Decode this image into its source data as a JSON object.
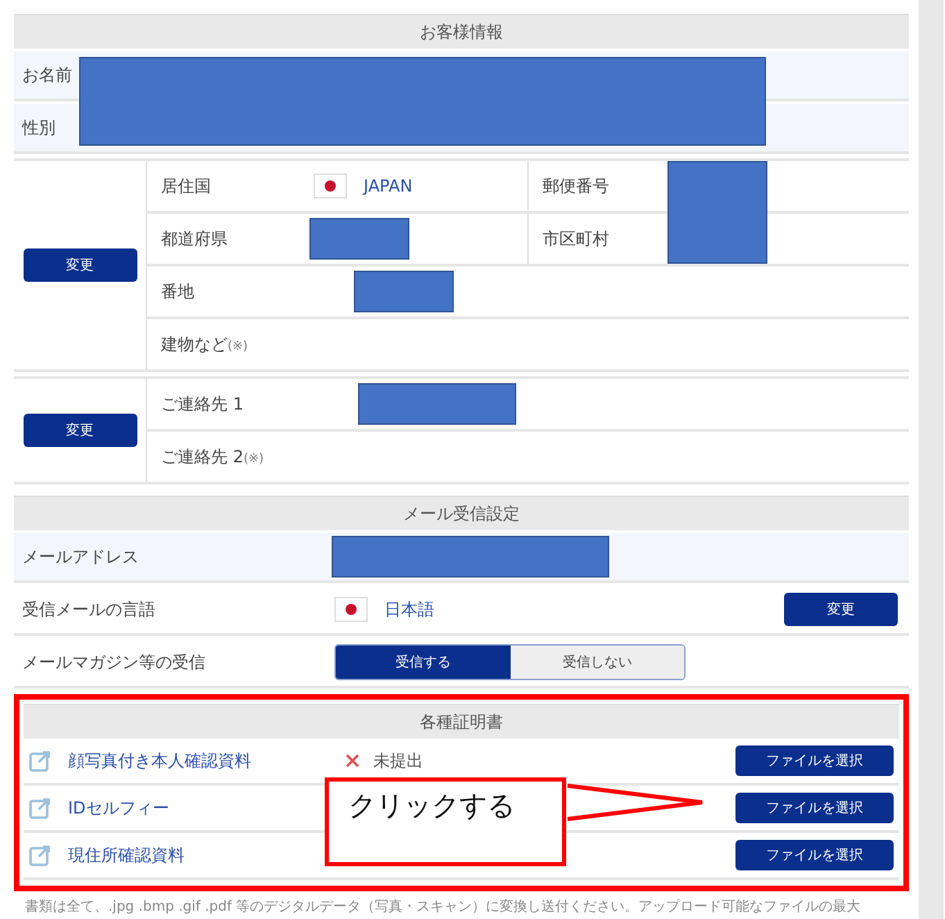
{
  "customer": {
    "title": "お客様情報",
    "fields": [
      {
        "label": "お名前"
      },
      {
        "label": "性別"
      }
    ],
    "address": {
      "button": "変更",
      "rows": [
        {
          "cells": [
            {
              "label": "居住国",
              "value": "JAPAN",
              "flag": true
            },
            {
              "label": "郵便番号"
            }
          ]
        },
        {
          "cells": [
            {
              "label": "都道府県"
            },
            {
              "label": "市区町村"
            }
          ]
        },
        {
          "cells": [
            {
              "label": "番地"
            }
          ]
        },
        {
          "cells": [
            {
              "label": "建物など",
              "note": "(※)"
            }
          ]
        }
      ]
    },
    "contact": {
      "button": "変更",
      "rows": [
        {
          "label": "ご連絡先 1"
        },
        {
          "label": "ご連絡先 2",
          "note": "(※)"
        }
      ]
    }
  },
  "mail": {
    "title": "メール受信設定",
    "address_label": "メールアドレス",
    "language_label": "受信メールの言語",
    "language": "日本語",
    "language_button": "変更",
    "magazine_label": "メールマガジン等の受信",
    "magazine_options": [
      {
        "label": "受信する",
        "selected": true
      },
      {
        "label": "受信しない",
        "selected": false
      }
    ]
  },
  "documents": {
    "title": "各種証明書",
    "items": [
      {
        "name": "顔写真付き本人確認資料",
        "status": "未提出",
        "button": "ファイルを選択"
      },
      {
        "name": "IDセルフィー",
        "button": "ファイルを選択"
      },
      {
        "name": "現住所確認資料",
        "button": "ファイルを選択"
      }
    ],
    "callout": "クリックする"
  },
  "footnote": "書類は全て、.jpg .bmp .gif .pdf 等のデジタルデータ（写真・スキャン）に変換し送付ください。アップロード可能なファイルの最大"
}
